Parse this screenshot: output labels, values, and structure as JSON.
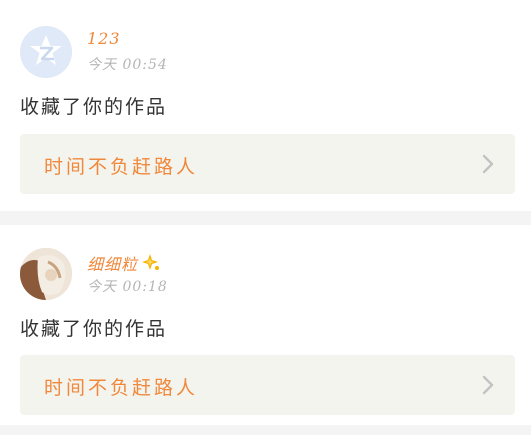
{
  "feed": [
    {
      "user": {
        "name": "123",
        "avatar": "qzone-logo-icon",
        "badge": null
      },
      "time": "今天 00:54",
      "action": "收藏了你的作品",
      "work": {
        "title": "时间不负赶路人",
        "icon": "chevron-right-icon"
      }
    },
    {
      "user": {
        "name": "细细粒",
        "avatar": "user-photo",
        "badge": "sparkle-badge-icon"
      },
      "time": "今天 00:18",
      "action": "收藏了你的作品",
      "work": {
        "title": "时间不负赶路人",
        "icon": "chevron-right-icon"
      }
    }
  ],
  "colors": {
    "accent": "#f0883c",
    "muted": "#b5b5b5",
    "text": "#333333",
    "card_bg": "#f4f4ef",
    "separator": "#f4f4f4"
  }
}
